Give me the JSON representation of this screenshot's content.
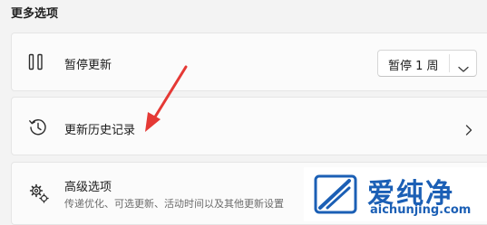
{
  "section_title": "更多选项",
  "pause_updates": {
    "icon": "pause-icon",
    "label": "暂停更新",
    "dropdown_value": "暂停 1 周"
  },
  "update_history": {
    "icon": "history-icon",
    "label": "更新历史记录"
  },
  "advanced_options": {
    "icon": "gears-icon",
    "label": "高级选项",
    "description": "传递优化、可选更新、活动时间以及其他更新设置"
  },
  "annotation": {
    "color": "#e53935"
  },
  "watermark": {
    "brand_text": "爱纯净",
    "url": "aichunjing.com",
    "color": "#1b5fb5"
  }
}
